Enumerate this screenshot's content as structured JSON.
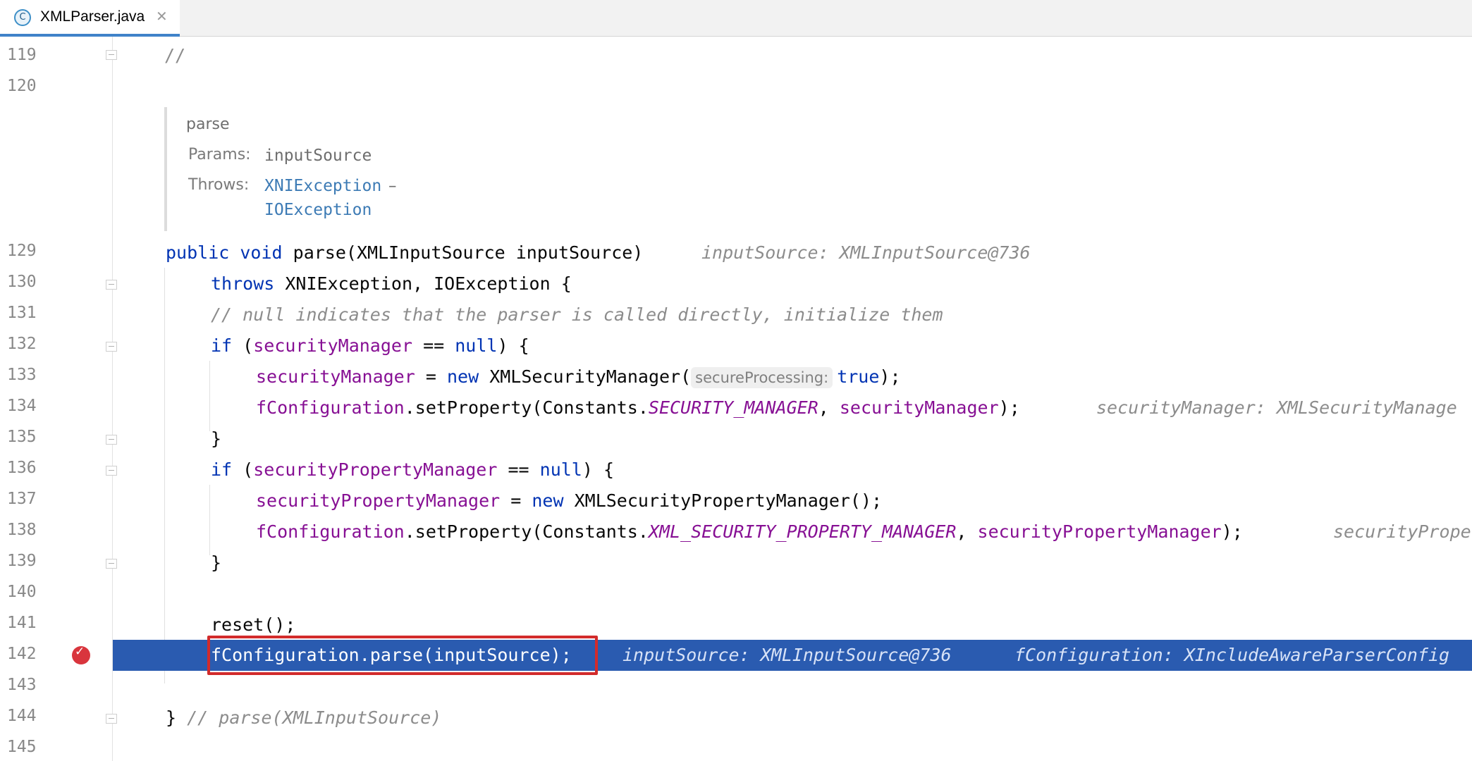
{
  "tab": {
    "icon": "class-c-icon",
    "icon_glyph": "C",
    "label": "XMLParser.java",
    "close_glyph": "✕"
  },
  "colors": {
    "keyword": "#0033b3",
    "field": "#871094",
    "comment": "#8c8c8c",
    "exec_line": "#2a5bb0",
    "highlight_box": "#d22b2b",
    "breakpoint": "#d9353d"
  },
  "line_numbers": [
    "119",
    "120",
    "129",
    "130",
    "131",
    "132",
    "133",
    "134",
    "135",
    "136",
    "137",
    "138",
    "139",
    "140",
    "141",
    "142",
    "143",
    "144",
    "145"
  ],
  "doc": {
    "title": "parse",
    "params_label": "Params:",
    "params_value": "inputSource",
    "throws_label": "Throws:",
    "throws_1": "XNIException",
    "throws_dash": "–",
    "throws_2": "IOException"
  },
  "code": {
    "l119": "//",
    "l129_kw1": "public",
    "l129_kw2": "void",
    "l129_rest": "parse(XMLInputSource inputSource)",
    "l129_hint": "inputSource: XMLInputSource@736",
    "l130_kw": "throws",
    "l130_rest": "XNIException, IOException {",
    "l131": "// null indicates that the parser is called directly, initialize them",
    "l132_kw": "if",
    "l132_a": "(",
    "l132_fld": "securityManager",
    "l132_b": "==",
    "l132_null": "null",
    "l132_c": ") {",
    "l133_fld": "securityManager",
    "l133_a": "=",
    "l133_new": "new",
    "l133_b": "XMLSecurityManager(",
    "l133_param": "secureProcessing:",
    "l133_true": "true",
    "l133_c": ");",
    "l134_fld": "fConfiguration",
    "l134_a": ".setProperty(Constants.",
    "l134_const": "SECURITY_MANAGER",
    "l134_b": ",",
    "l134_fld2": "securityManager",
    "l134_c": ");",
    "l134_hint": "securityManager: XMLSecurityManage",
    "l135": "}",
    "l136_kw": "if",
    "l136_a": "(",
    "l136_fld": "securityPropertyManager",
    "l136_b": "==",
    "l136_null": "null",
    "l136_c": ") {",
    "l137_fld": "securityPropertyManager",
    "l137_a": "=",
    "l137_new": "new",
    "l137_b": "XMLSecurityPropertyManager();",
    "l138_fld": "fConfiguration",
    "l138_a": ".setProperty(Constants.",
    "l138_const": "XML_SECURITY_PROPERTY_MANAGER",
    "l138_b": ",",
    "l138_fld2": "securityPropertyManager",
    "l138_c": ");",
    "l138_hint": "securityPrope",
    "l139": "}",
    "l141": "reset();",
    "l142": "fConfiguration.parse(inputSource);",
    "l142_hint1": "inputSource: XMLInputSource@736",
    "l142_hint2": "fConfiguration: XIncludeAwareParserConfig",
    "l144_brace": "}",
    "l144_cmt": "// parse(XMLInputSource)"
  }
}
